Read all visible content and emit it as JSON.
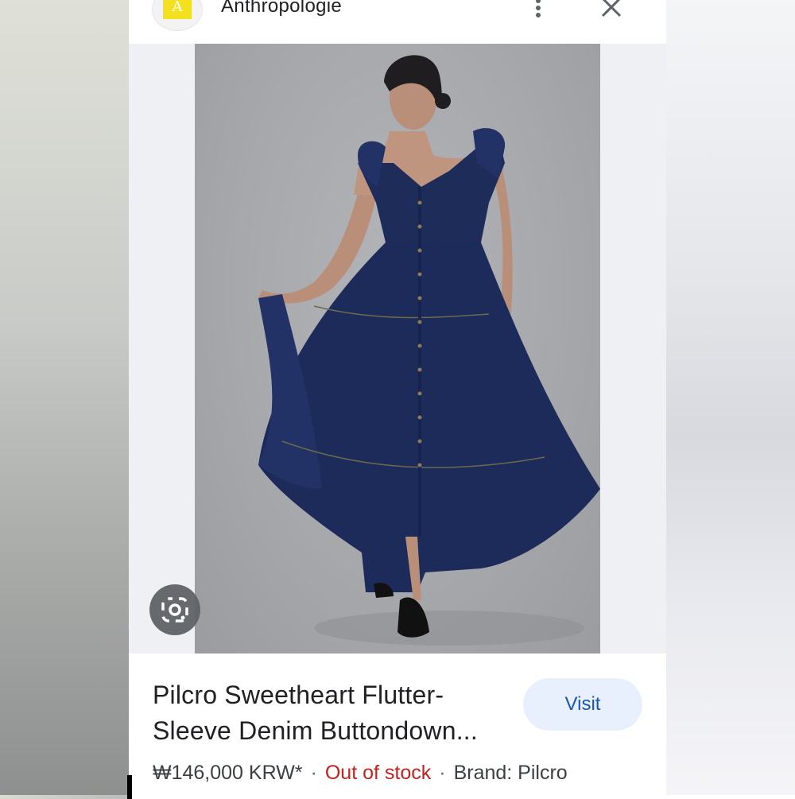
{
  "header": {
    "favicon_letter": "A",
    "site_name": "Anthropologie",
    "menu_icon": "more-vert-icon",
    "close_icon": "close-icon"
  },
  "image": {
    "lens_icon": "google-lens-icon"
  },
  "result": {
    "title": "Pilcro Sweetheart Flutter-Sleeve Denim Buttondown...",
    "visit_label": "Visit",
    "price": "₩146,000 KRW*",
    "separator": "·",
    "stock": "Out of stock",
    "brand": "Brand: Pilcro"
  },
  "colors": {
    "brand_yellow": "#f5e01f",
    "visit_bg": "#e8f0fe",
    "visit_text": "#1a56b8",
    "out_of_stock": "#c5221f"
  }
}
